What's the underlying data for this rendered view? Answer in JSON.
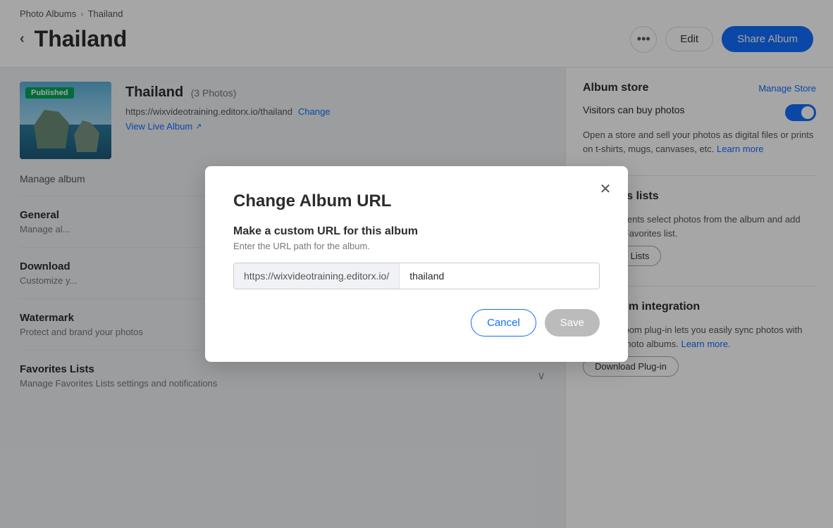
{
  "breadcrumb": {
    "parent": "Photo Albums",
    "current": "Thailand"
  },
  "header": {
    "back_label": "‹",
    "title": "Thailand",
    "dots_icon": "•••",
    "edit_label": "Edit",
    "share_label": "Share Album"
  },
  "album": {
    "title": "Thailand",
    "count": "(3 Photos)",
    "url": "https://wixvideotraining.editorx.io/thailand",
    "change_label": "Change",
    "view_live_label": "View Live Album",
    "published_badge": "Published"
  },
  "left_panel": {
    "manage_header": "Manage album",
    "sections": [
      {
        "title": "General",
        "subtitle": "Manage al..."
      },
      {
        "title": "Download",
        "subtitle": "Customize y..."
      },
      {
        "title": "Watermark",
        "subtitle": "Protect and brand your photos"
      },
      {
        "title": "Favorites Lists",
        "subtitle": "Manage Favorites Lists settings and notifications"
      }
    ]
  },
  "right_panel": {
    "album_store": {
      "title": "Album store",
      "manage_label": "Manage Store",
      "toggle_label": "Visitors can buy photos",
      "toggle_on": true,
      "description": "Open a store and sell your photos as digital files or prints on t-shirts, mugs, canvases, etc.",
      "learn_more": "Learn more"
    },
    "favorites": {
      "title": "Favorites lists",
      "description": "Let your clients select photos from the album and add them to a Favorites list.",
      "manage_label": "Manage Lists"
    },
    "lightroom": {
      "title": "Lightroom integration",
      "description": "The Lightroom plug-in lets you easily sync photos with your Wix photo albums.",
      "learn_more": "Learn more.",
      "download_label": "Download Plug-in"
    }
  },
  "modal": {
    "title": "Change Album URL",
    "subtitle": "Make a custom URL for this album",
    "hint": "Enter the URL path for the album.",
    "url_base": "https://wixvideotraining.editorx.io/",
    "url_value": "thailand",
    "url_placeholder": "thailand",
    "cancel_label": "Cancel",
    "save_label": "Save",
    "close_icon": "✕"
  }
}
